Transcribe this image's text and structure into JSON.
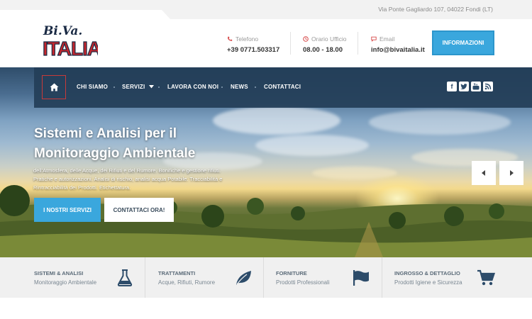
{
  "topbar": {
    "address": "Via Ponte Gagliardo 107, 04022 Fondi (LT)"
  },
  "logo": {
    "line1": "Bi.Va.",
    "line2": "ITALIA"
  },
  "contacts": [
    {
      "label": "Telefono",
      "value": "+39 0771.503317",
      "icon": "phone-icon"
    },
    {
      "label": "Orario Ufficio",
      "value": "08.00 - 18.00",
      "icon": "clock-icon"
    },
    {
      "label": "Email",
      "value": "info@bivaitalia.it",
      "icon": "chat-icon"
    }
  ],
  "info_button": "INFORMAZIONI",
  "nav": {
    "items": [
      "CHI SIAMO",
      "SERVIZI",
      "LAVORA CON NOI",
      "NEWS",
      "CONTATTACI"
    ],
    "social": [
      "facebook-icon",
      "twitter-icon",
      "youtube-icon",
      "rss-icon"
    ]
  },
  "hero": {
    "title_line1": "Sistemi e Analisi per il",
    "title_line2": "Monitoraggio Ambientale",
    "description": "dell'Atmosfera, delle Acque, dei Rifiuti e del Rumore. Bonifiche e gestione rifiuti. Pratiche e autorizzazioni. Analisi di rischio, analisi acqua Potabile. Tracciabilità e Rintracciabilità dei Prodotti. Etichettatura.",
    "primary_button": "I NOSTRI SERVIZI",
    "secondary_button": "CONTATTACI ORA!"
  },
  "features": [
    {
      "title": "SISTEMI & ANALISI",
      "subtitle": "Monitoraggio Ambientale",
      "icon": "flask-icon"
    },
    {
      "title": "TRATTAMENTI",
      "subtitle": "Acque, Rifiuti, Rumore",
      "icon": "leaf-icon"
    },
    {
      "title": "FORNITURE",
      "subtitle": "Prodotti Professionali",
      "icon": "flag-icon"
    },
    {
      "title": "INGROSSO & DETTAGLIO",
      "subtitle": "Prodotti Igiene e Sicurezza",
      "icon": "cart-icon"
    }
  ],
  "colors": {
    "accent": "#3aa7dd",
    "nav": "#233e58",
    "brand_red": "#c8262c",
    "icon": "#2d4c6a"
  }
}
